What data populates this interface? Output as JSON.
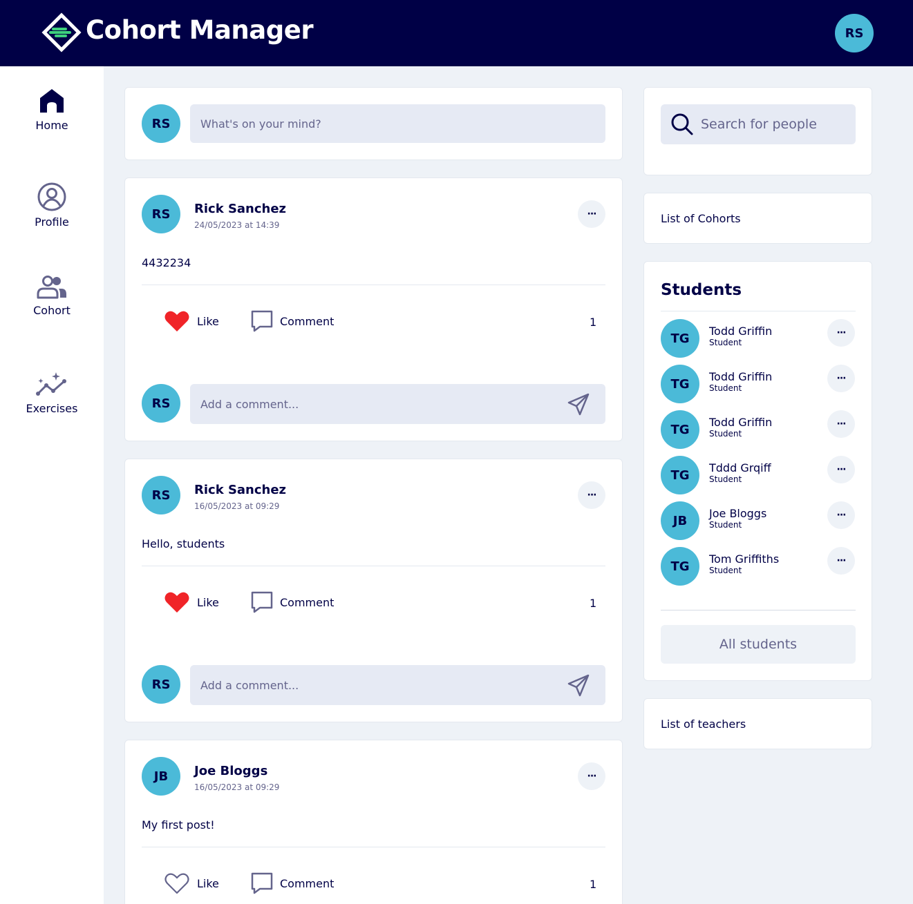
{
  "header": {
    "app_title": "Cohort Manager",
    "user_initials": "RS",
    "background_color": "#000046",
    "accent_color": "#4bbad8"
  },
  "sidebar": {
    "items": [
      {
        "label": "Home",
        "icon": "home-icon",
        "active": true
      },
      {
        "label": "Profile",
        "icon": "profile-icon",
        "active": false
      },
      {
        "label": "Cohort",
        "icon": "cohort-icon",
        "active": false
      },
      {
        "label": "Exercises",
        "icon": "exercises-icon",
        "active": false
      }
    ]
  },
  "composer": {
    "user_initials": "RS",
    "placeholder": "What's on your mind?"
  },
  "posts": [
    {
      "initials": "RS",
      "author": "Rick Sanchez",
      "date": "24/05/2023 at 14:39",
      "body": "4432234",
      "like_label": "Like",
      "liked": true,
      "comment_label": "Comment",
      "like_count": "1",
      "comment_initials": "RS",
      "comment_placeholder": "Add a comment..."
    },
    {
      "initials": "RS",
      "author": "Rick Sanchez",
      "date": "16/05/2023 at 09:29",
      "body": "Hello, students",
      "like_label": "Like",
      "liked": true,
      "comment_label": "Comment",
      "like_count": "1",
      "comment_initials": "RS",
      "comment_placeholder": "Add a comment..."
    },
    {
      "initials": "JB",
      "author": "Joe Bloggs",
      "date": "16/05/2023 at 09:29",
      "body": "My first post!",
      "like_label": "Like",
      "liked": false,
      "comment_label": "Comment",
      "like_count": "1"
    }
  ],
  "search": {
    "placeholder": "Search for people"
  },
  "cohorts_link": "List of Cohorts",
  "students": {
    "title": "Students",
    "list": [
      {
        "initials": "TG",
        "name": "Todd Griffin",
        "role": "Student"
      },
      {
        "initials": "TG",
        "name": "Todd Griffin",
        "role": "Student"
      },
      {
        "initials": "TG",
        "name": "Todd Griffin",
        "role": "Student"
      },
      {
        "initials": "TG",
        "name": "Tddd Grqiff",
        "role": "Student"
      },
      {
        "initials": "JB",
        "name": "Joe Bloggs",
        "role": "Student"
      },
      {
        "initials": "TG",
        "name": "Tom Griffiths",
        "role": "Student"
      }
    ],
    "all_button": "All students"
  },
  "teachers_link": "List of teachers",
  "more_glyph": "···"
}
